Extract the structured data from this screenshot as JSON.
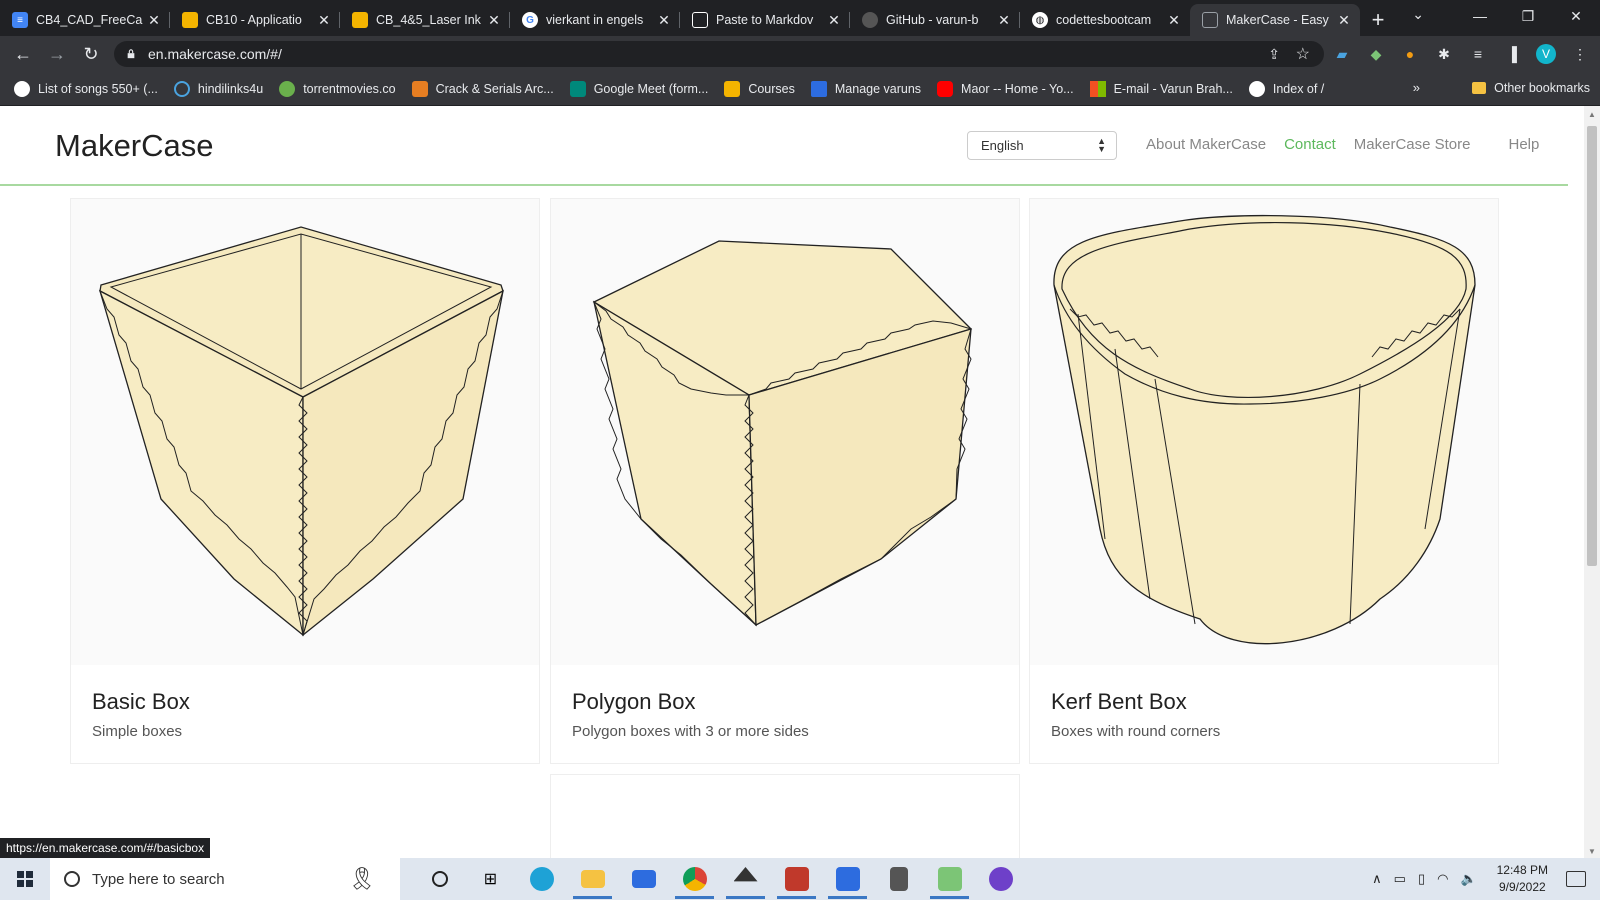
{
  "browser": {
    "tabs": [
      {
        "title": "CB4_CAD_FreeCa",
        "color": "#4285f4",
        "glyph": "doc-icon"
      },
      {
        "title": "CB10 - Applicatio",
        "color": "#f4b400",
        "glyph": "slides-icon"
      },
      {
        "title": "CB_4&5_Laser Ink",
        "color": "#f4b400",
        "glyph": "slides-icon"
      },
      {
        "title": "vierkant in engels",
        "color": "#ffffff",
        "glyph": "google-icon"
      },
      {
        "title": "Paste to Markdov",
        "color": "#ffffff",
        "glyph": "clipboard-icon"
      },
      {
        "title": "GitHub - varun-b",
        "color": "#333333",
        "glyph": "github-icon"
      },
      {
        "title": "codettesbootcam",
        "color": "#ffffff",
        "glyph": "globe-icon"
      },
      {
        "title": "MakerCase - Easy",
        "color": "#35363a",
        "glyph": "page-icon"
      }
    ],
    "url": "en.makercase.com/#/",
    "bookmarks": [
      {
        "label": "List of songs 550+ (...",
        "color": "#ffffff"
      },
      {
        "label": "hindilinks4u",
        "color": "#4aa3df"
      },
      {
        "label": "torrentmovies.co",
        "color": "#6ab04c"
      },
      {
        "label": "Crack & Serials Arc...",
        "color": "#e67e22"
      },
      {
        "label": "Google Meet (form...",
        "color": "#00897b"
      },
      {
        "label": "Courses",
        "color": "#f4b400"
      },
      {
        "label": "Manage varuns",
        "color": "#2d6cdf"
      },
      {
        "label": "Maor -- Home - Yo...",
        "color": "#ff0000"
      },
      {
        "label": "E-mail - Varun Brah...",
        "color": "#f25022"
      },
      {
        "label": "Index of /",
        "color": "#ffffff"
      }
    ],
    "more_bookmarks": "»",
    "other_bookmarks": "Other bookmarks",
    "avatar_letter": "V",
    "status_url": "https://en.makercase.com/#/basicbox"
  },
  "site": {
    "brand": "MakerCase",
    "language": "English",
    "nav": {
      "about": "About MakerCase",
      "contact": "Contact",
      "store": "MakerCase Store",
      "help": "Help"
    },
    "cards": [
      {
        "title": "Basic Box",
        "desc": "Simple boxes"
      },
      {
        "title": "Polygon Box",
        "desc": "Polygon boxes with 3 or more sides"
      },
      {
        "title": "Kerf Bent Box",
        "desc": "Boxes with round corners"
      }
    ]
  },
  "taskbar": {
    "search_placeholder": "Type here to search",
    "time": "12:48 PM",
    "date": "9/9/2022"
  }
}
